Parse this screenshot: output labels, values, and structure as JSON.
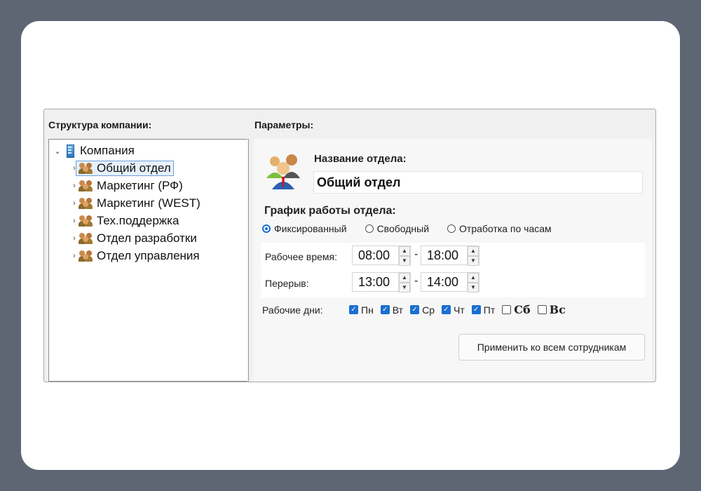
{
  "left_pane": {
    "title": "Структура компании:",
    "root": "Компания",
    "items": [
      {
        "label": "Общий отдел",
        "selected": true
      },
      {
        "label": "Маркетинг (РФ)"
      },
      {
        "label": "Маркетинг (WEST)"
      },
      {
        "label": "Тех.поддержка"
      },
      {
        "label": "Отдел разработки"
      },
      {
        "label": "Отдел управления"
      }
    ]
  },
  "right_pane": {
    "title": "Параметры:",
    "dept_name_label": "Название отдела:",
    "dept_name_value": "Общий отдел",
    "schedule_label": "График работы отдела:",
    "schedule_options": [
      "Фиксированный",
      "Свободный",
      "Отработка по часам"
    ],
    "schedule_selected": "Фиксированный",
    "work_time_label": "Рабочее время:",
    "work_start": "08:00",
    "work_end": "18:00",
    "break_label": "Перерыв:",
    "break_start": "13:00",
    "break_end": "14:00",
    "dash": "-",
    "days_label": "Рабочие дни:",
    "days": [
      {
        "label": "Пн",
        "checked": true
      },
      {
        "label": "Вт",
        "checked": true
      },
      {
        "label": "Ср",
        "checked": true
      },
      {
        "label": "Чт",
        "checked": true
      },
      {
        "label": "Пт",
        "checked": true
      },
      {
        "label": "Сб",
        "checked": false
      },
      {
        "label": "Вс",
        "checked": false
      }
    ],
    "apply_button": "Применить ко всем сотрудникам"
  },
  "colors": {
    "backdrop": "#5e6673",
    "accent": "#1a6fd1",
    "selection": "#e6f1fc"
  },
  "icons": {
    "root": "building-icon",
    "group": "group-users-icon",
    "department": "department-people-icon",
    "chevron_expanded": "chevron-down-icon",
    "chevron_collapsed": "chevron-right-icon"
  }
}
